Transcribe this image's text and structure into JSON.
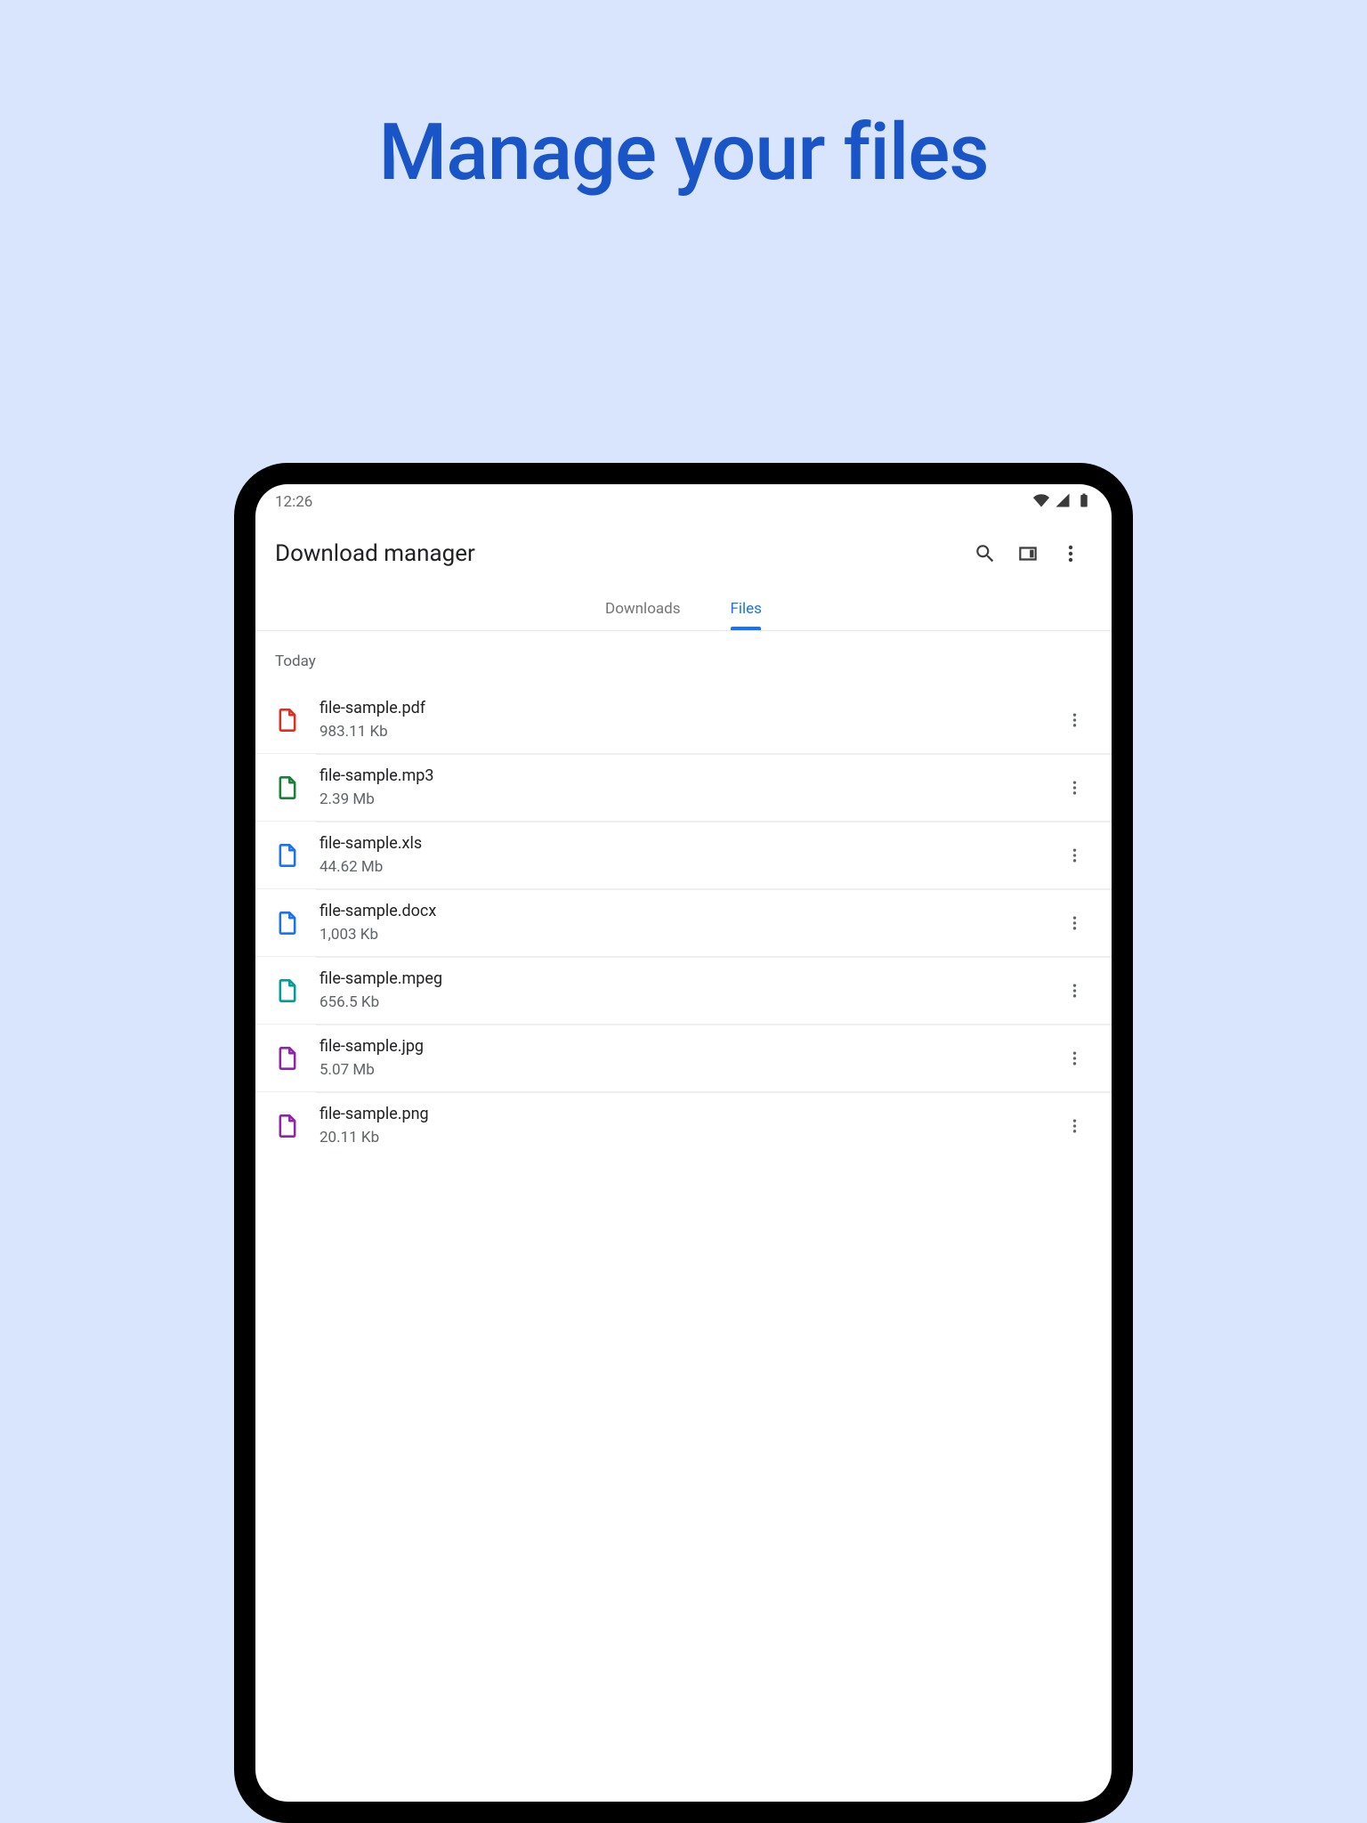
{
  "hero": "Manage your files",
  "status": {
    "time": "12:26"
  },
  "appbar": {
    "title": "Download manager"
  },
  "tabs": {
    "downloads": "Downloads",
    "files": "Files"
  },
  "section": {
    "today": "Today"
  },
  "files": [
    {
      "name": "file-sample.pdf",
      "size": "983.11 Kb",
      "color": "#d93025"
    },
    {
      "name": "file-sample.mp3",
      "size": "2.39 Mb",
      "color": "#188038"
    },
    {
      "name": "file-sample.xls",
      "size": "44.62 Mb",
      "color": "#1a73e8"
    },
    {
      "name": "file-sample.docx",
      "size": "1,003 Kb",
      "color": "#1a73e8"
    },
    {
      "name": "file-sample.mpeg",
      "size": "656.5 Kb",
      "color": "#009b9b"
    },
    {
      "name": "file-sample.jpg",
      "size": "5.07 Mb",
      "color": "#8e24aa"
    },
    {
      "name": "file-sample.png",
      "size": "20.11 Kb",
      "color": "#8e24aa"
    }
  ]
}
